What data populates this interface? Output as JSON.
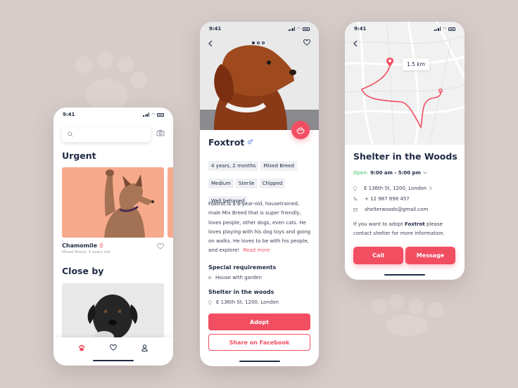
{
  "status_time": "9:41",
  "phone1": {
    "sections": {
      "urgent": "Urgent",
      "close_by": "Close by"
    },
    "card": {
      "name": "Chamomile",
      "gender_symbol": "♀",
      "meta": "Mixed Breed, 4 years old"
    }
  },
  "phone2": {
    "name": "Foxtrot",
    "gender_symbol": "♂",
    "tags": [
      "4 years, 2 months",
      "Mixed Breed",
      "Medium",
      "Sterile",
      "Chipped",
      "Well behaved"
    ],
    "description": "Foxtrot is a 6-year-old, housetrained, male Mix Breed that is super friendly, loves people, other dogs, even cats. He loves playing with his dog toys and going on walks. He loves to be with his people, and explore!",
    "read_more": "Read more",
    "special_title": "Special requirements",
    "special_item": "House with garden",
    "shelter_title": "Shelter in the woods",
    "shelter_address": "E 136th St, 1200, London",
    "adopt_label": "Adopt",
    "share_label": "Share on Facebook"
  },
  "phone3": {
    "distance": "1.5 km",
    "title": "Shelter in the Woods",
    "open_label": "Open:",
    "hours": "9:00 am - 5:00 pm",
    "address": "E 136th St, 1200, London",
    "phone": "+ 12 987 898 457",
    "email": "shelterwoods@gmail.com",
    "adopt_note_prefix": "If you want to adopt ",
    "adopt_note_name": "Foxtrot",
    "adopt_note_suffix": " please contact shelter for more information.",
    "call_label": "Call",
    "message_label": "Message"
  },
  "colors": {
    "accent": "#f24e62",
    "open": "#3cc26b",
    "card_bg": "#f7a98c",
    "text": "#1f2a44"
  },
  "icons": [
    "search-icon",
    "camera-icon",
    "heart-icon",
    "paw-icon",
    "user-icon",
    "back-icon",
    "map-pin-icon",
    "phone-icon",
    "mail-icon",
    "chevron-right-icon",
    "chevron-down-icon"
  ]
}
